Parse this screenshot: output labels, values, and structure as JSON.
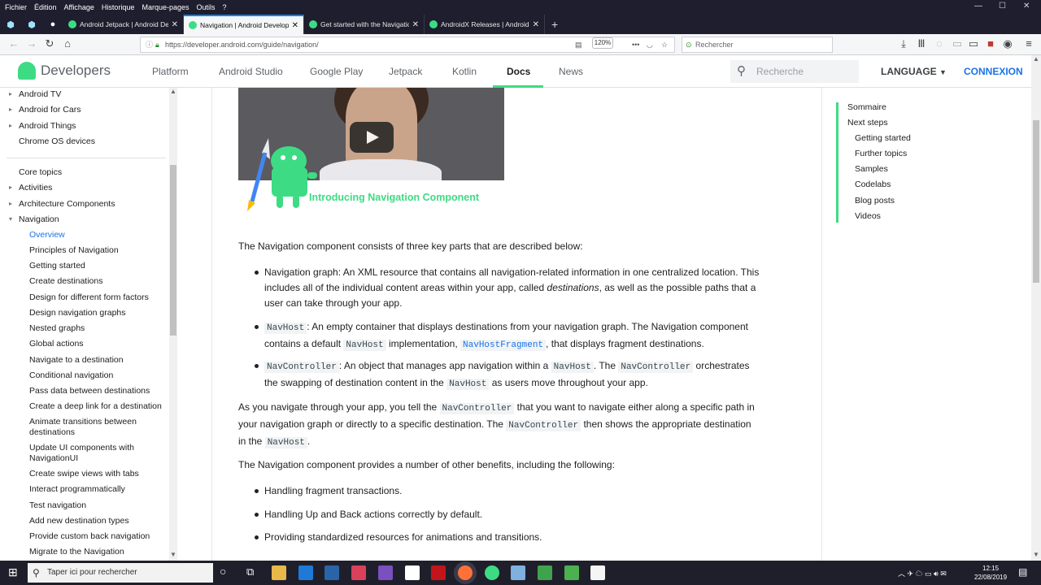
{
  "browser": {
    "menu": [
      "Fichier",
      "Édition",
      "Affichage",
      "Historique",
      "Marque-pages",
      "Outils",
      "?"
    ],
    "tabs": [
      {
        "title": "Android Jetpack | Android De",
        "active": false
      },
      {
        "title": "Navigation | Android Develop",
        "active": true
      },
      {
        "title": "Get started with the Navigation",
        "active": false
      },
      {
        "title": "AndroidX Releases | Android D",
        "active": false
      }
    ],
    "url": "https://developer.android.com/guide/navigation/",
    "zoom": "120%",
    "search_placeholder": "Rechercher"
  },
  "site": {
    "logo": "Developers",
    "nav": [
      "Platform",
      "Android Studio",
      "Google Play",
      "Jetpack",
      "Kotlin",
      "Docs",
      "News"
    ],
    "active_nav": "Docs",
    "search_placeholder": "Recherche",
    "language": "LANGUAGE",
    "login": "CONNEXION"
  },
  "sidebar": {
    "top": [
      "Android TV",
      "Android for Cars",
      "Android Things",
      "Chrome OS devices"
    ],
    "sections": [
      "Core topics",
      "Activities",
      "Architecture Components",
      "Navigation"
    ],
    "navigation_items": [
      "Overview",
      "Principles of Navigation",
      "Getting started",
      "Create destinations",
      "Design for different form factors",
      "Design navigation graphs",
      "Nested graphs",
      "Global actions",
      "Navigate to a destination",
      "Conditional navigation",
      "Pass data between destinations",
      "Create a deep link for a destination",
      "Animate transitions between destinations",
      "Update UI components with NavigationUI",
      "Create swipe views with tabs",
      "Interact programmatically",
      "Test navigation",
      "Add new destination types",
      "Provide custom back navigation",
      "Migrate to the Navigation"
    ]
  },
  "content": {
    "video_title": "Introducing Navigation Component",
    "intro": "The Navigation component consists of three key parts that are described below:",
    "b1_lead": "Navigation graph: An XML resource that contains all navigation-related information in one centralized location. This",
    "b1_l2a": "includes all of the individual content areas within your app, called ",
    "b1_em": "destinations",
    "b1_l2b": ", as well as the possible paths that a",
    "b1_l3": "user can take through your app.",
    "b2_code1": "NavHost",
    "b2_l1": ": An empty container that displays destinations from your navigation graph. The Navigation component",
    "b2_l2a": "contains a default ",
    "b2_code2": "NavHost",
    "b2_l2b": " implementation, ",
    "b2_link": "NavHostFragment",
    "b2_l2c": ", that displays fragment destinations.",
    "b3_code1": "NavController",
    "b3_l1a": ": An object that manages app navigation within a ",
    "b3_code2": "NavHost",
    "b3_l1b": ". The ",
    "b3_code3": "NavController",
    "b3_l1c": " orchestrates",
    "b3_l2a": "the swapping of destination content in the ",
    "b3_code4": "NavHost",
    "b3_l2b": " as users move throughout your app.",
    "p2_l1a": "As you navigate through your app, you tell the ",
    "p2_code1": "NavController",
    "p2_l1b": " that you want to navigate either along a specific path in",
    "p2_l2a": "your navigation graph or directly to a specific destination. The ",
    "p2_code2": "NavController",
    "p2_l2b": " then shows the appropriate destination",
    "p2_l3a": "in the ",
    "p2_code3": "NavHost",
    "p2_l3b": ".",
    "p3": "The Navigation component provides a number of other benefits, including the following:",
    "benefits": [
      "Handling fragment transactions.",
      "Handling Up and Back actions correctly by default.",
      "Providing standardized resources for animations and transitions."
    ]
  },
  "toc": {
    "title": "Sommaire",
    "items": [
      "Next steps",
      "Getting started",
      "Further topics",
      "Samples",
      "Codelabs",
      "Blog posts",
      "Videos"
    ]
  },
  "taskbar": {
    "search": "Taper ici pour rechercher",
    "time": "12:15",
    "date": "22/08/2019"
  },
  "colors": {
    "accent": "#3ddc84",
    "link": "#1a73e8",
    "taskbar": "#1f1f2b"
  }
}
